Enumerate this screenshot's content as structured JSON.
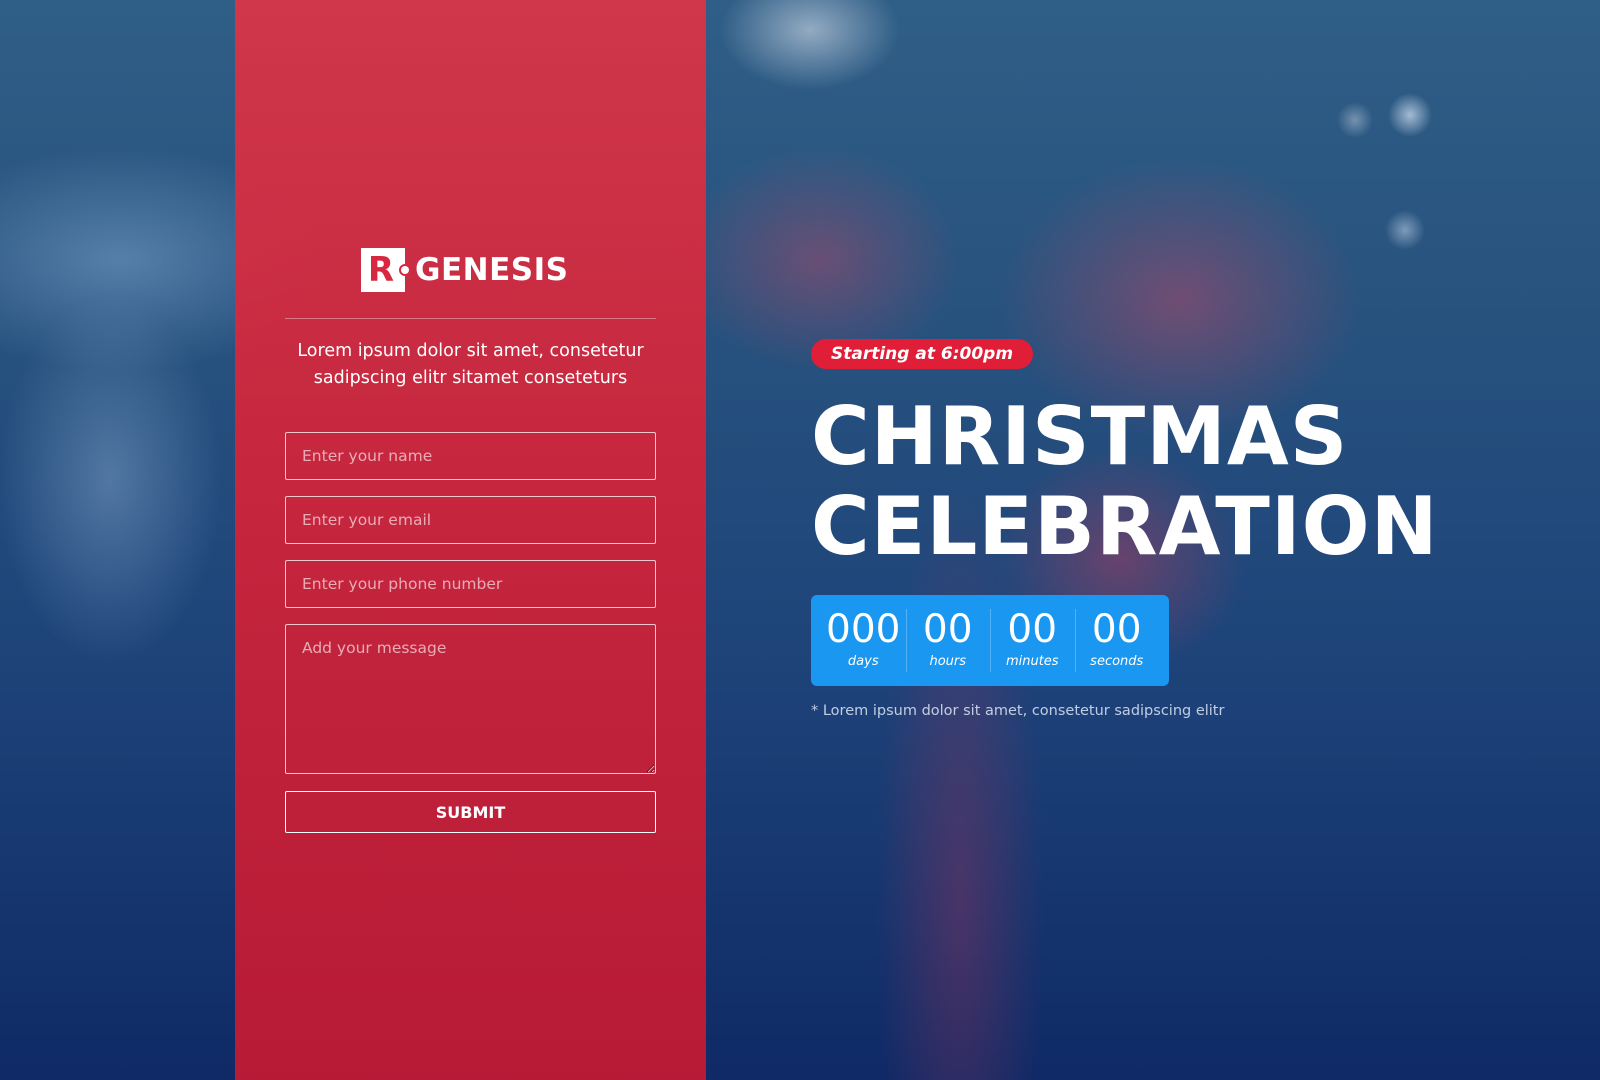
{
  "brand": {
    "logo_letter": "R",
    "name": "GENESIS"
  },
  "form": {
    "intro": "Lorem ipsum dolor sit amet, consetetur sadipscing elitr sitamet conseteturs",
    "name_placeholder": "Enter your name",
    "email_placeholder": "Enter your email",
    "phone_placeholder": "Enter your phone number",
    "message_placeholder": "Add your message",
    "submit_label": "SUBMIT"
  },
  "event": {
    "badge": "Starting at 6:00pm",
    "title_line1": "CHRISTMAS",
    "title_line2": "CELEBRATION",
    "countdown": [
      {
        "value": "000",
        "label": "days"
      },
      {
        "value": "00",
        "label": "hours"
      },
      {
        "value": "00",
        "label": "minutes"
      },
      {
        "value": "00",
        "label": "seconds"
      }
    ],
    "note": "* Lorem ipsum dolor sit amet, consetetur sadipscing elitr"
  },
  "colors": {
    "panel_red": "#d0243a",
    "badge_red": "#e01e38",
    "countdown_blue": "#1a97f0",
    "background_navy": "#0f2a66"
  }
}
